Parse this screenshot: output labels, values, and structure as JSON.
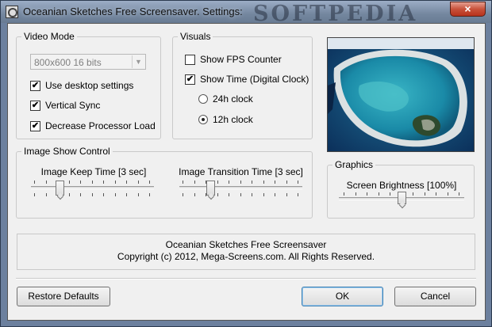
{
  "window": {
    "title": "Oceanian Sketches Free Screensaver. Settings:",
    "watermark": "SOFTPEDIA",
    "close_glyph": "×"
  },
  "video_mode": {
    "title": "Video Mode",
    "resolution": "800x600 16 bits",
    "options": [
      {
        "label": "Use desktop settings",
        "checked": true
      },
      {
        "label": "Vertical Sync",
        "checked": true
      },
      {
        "label": "Decrease Processor Load",
        "checked": true
      }
    ]
  },
  "visuals": {
    "title": "Visuals",
    "show_fps": {
      "label": "Show FPS Counter",
      "checked": false
    },
    "show_time": {
      "label": "Show Time (Digital Clock)",
      "checked": true
    },
    "clock_24h": {
      "label": "24h clock",
      "selected": false
    },
    "clock_12h": {
      "label": "12h clock",
      "selected": true
    }
  },
  "image_show": {
    "title": "Image Show Control",
    "keep_time": {
      "label": "Image Keep Time [3 sec]",
      "level": 0.2
    },
    "transition_time": {
      "label": "Image Transition Time [3 sec]",
      "level": 0.22
    }
  },
  "graphics": {
    "title": "Graphics",
    "brightness": {
      "label": "Screen Brightness [100%]",
      "level": 0.5
    }
  },
  "info": {
    "line1": "Oceanian Sketches Free Screensaver",
    "line2": "Copyright (c) 2012, Mega-Screens.com. All Rights Reserved."
  },
  "buttons": {
    "restore": "Restore Defaults",
    "ok": "OK",
    "cancel": "Cancel"
  },
  "icons": {
    "checkmark": "✔",
    "dropdown": "▼"
  }
}
